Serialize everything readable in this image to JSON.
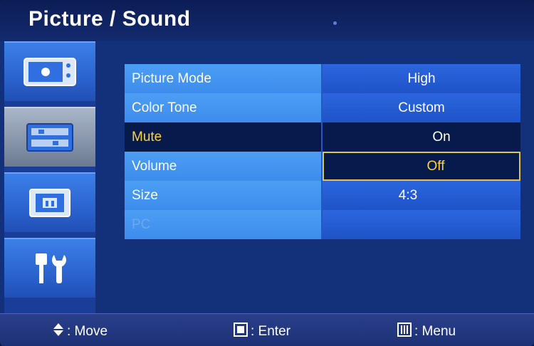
{
  "header": {
    "title": "Picture / Sound"
  },
  "sidebar": {
    "tabs": [
      {
        "icon": "tv-picture-icon",
        "active": false
      },
      {
        "icon": "sound-panel-icon",
        "active": true
      },
      {
        "icon": "screen-size-icon",
        "active": false
      },
      {
        "icon": "setup-tools-icon",
        "active": false
      }
    ]
  },
  "menu": {
    "rows": [
      {
        "label": "Picture Mode",
        "value": "High",
        "state": "normal"
      },
      {
        "label": "Color Tone",
        "value": "Custom",
        "state": "normal"
      },
      {
        "label": "Mute",
        "value": "On",
        "state": "selected"
      },
      {
        "label": "Volume",
        "value": "Off",
        "state": "editing"
      },
      {
        "label": "Size",
        "value": "4:3",
        "state": "normal"
      },
      {
        "label": "PC",
        "value": "",
        "state": "disabled"
      }
    ]
  },
  "footer": {
    "move": {
      "icon": "up-down-arrow-icon",
      "label": ": Move"
    },
    "enter": {
      "icon": "enter-square-icon",
      "label": ": Enter"
    },
    "menu": {
      "icon": "menu-bars-icon",
      "label": ": Menu"
    }
  },
  "colors": {
    "selected_label_text": "#ffd23a",
    "editing_border": "#e4c24a",
    "row_label_bg": "#4c9ef4",
    "row_value_bg": "#2b66de"
  }
}
